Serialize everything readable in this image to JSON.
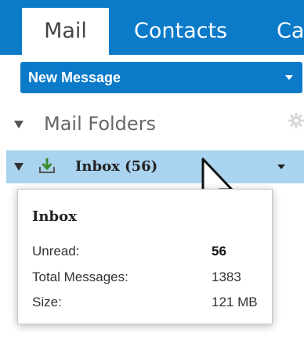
{
  "tabs": {
    "mail": "Mail",
    "contacts": "Contacts",
    "calendar": "Ca"
  },
  "new_message": {
    "label": "New Message"
  },
  "folders": {
    "header": "Mail Folders",
    "inbox_label": "Inbox (56)"
  },
  "tooltip": {
    "title": "Inbox",
    "rows": [
      {
        "label": "Unread:",
        "value": "56"
      },
      {
        "label": "Total Messages:",
        "value": "1383"
      },
      {
        "label": "Size:",
        "value": "121 MB"
      }
    ]
  },
  "icons": {
    "gear": "gear-icon",
    "download": "download-icon",
    "cursor": "mouse-cursor-icon"
  },
  "colors": {
    "accent": "#0a7ac9",
    "selected_row": "#a9d3ef"
  }
}
